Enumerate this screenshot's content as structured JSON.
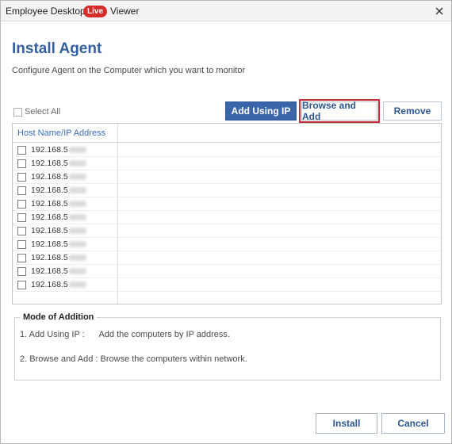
{
  "window": {
    "app_name": "Employee Desktop",
    "live_badge": "Live",
    "viewer_text": "Viewer",
    "close_icon": "close-icon"
  },
  "page": {
    "title": "Install Agent",
    "subtitle": "Configure Agent on the Computer which you want to monitor"
  },
  "toolbar": {
    "select_all_label": "Select All",
    "add_ip_label": "Add Using IP",
    "browse_add_label": "Browse and Add",
    "remove_label": "Remove"
  },
  "grid": {
    "column_header": "Host Name/IP Address",
    "rows": [
      "192.168.5",
      "192.168.5",
      "192.168.5",
      "192.168.5",
      "192.168.5",
      "192.168.5",
      "192.168.5",
      "192.168.5",
      "192.168.5",
      "192.168.5",
      "192.168.5"
    ]
  },
  "mode": {
    "title": "Mode of Addition",
    "line1": "1. Add Using IP :      Add the computers by IP address.",
    "line2": "2. Browse and Add : Browse the computers within network."
  },
  "footer": {
    "install_label": "Install",
    "cancel_label": "Cancel"
  },
  "colors": {
    "accent": "#3a66a9",
    "heading": "#34609f",
    "live_badge": "#d52b2b",
    "highlight_border": "#c62f38"
  }
}
